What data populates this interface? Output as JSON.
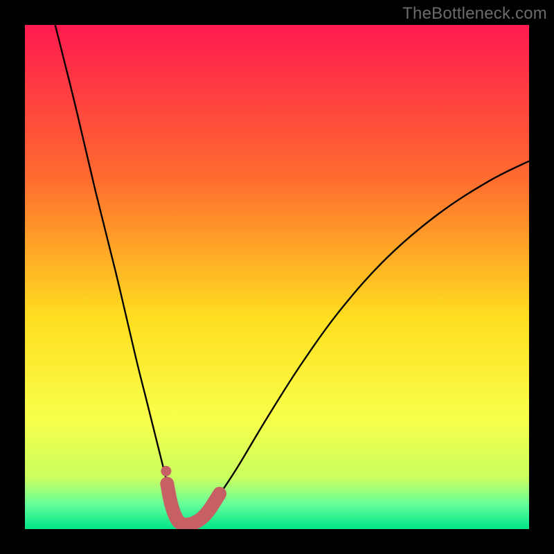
{
  "watermark": "TheBottleneck.com",
  "colors": {
    "frame": "#000000",
    "grad_top": "#ff1a4f",
    "grad_mid1": "#ff6a2f",
    "grad_mid2": "#ffde20",
    "grad_mid3": "#f8ff4a",
    "grad_low1": "#c8ff60",
    "grad_low2": "#66ff99",
    "grad_bottom": "#00e58a",
    "curve": "#000000",
    "marker_fill": "#c76065",
    "marker_stroke": "#c76065"
  },
  "chart_data": {
    "type": "line",
    "title": "",
    "xlabel": "",
    "ylabel": "",
    "xlim": [
      0,
      100
    ],
    "ylim": [
      0,
      100
    ],
    "series": [
      {
        "name": "bottleneck-curve",
        "x": [
          6,
          10,
          14,
          18,
          22,
          24,
          26,
          28,
          29.5,
          31,
          33,
          35,
          38,
          42,
          48,
          55,
          63,
          72,
          82,
          92,
          100
        ],
        "y": [
          100,
          84,
          67,
          51,
          34,
          26,
          18,
          10,
          4,
          1,
          1,
          2,
          6,
          12,
          22,
          33,
          44,
          54,
          62.5,
          69,
          73
        ]
      }
    ],
    "markers": {
      "name": "highlight-segment",
      "points": [
        {
          "x": 28.2,
          "y": 9
        },
        {
          "x": 29,
          "y": 5
        },
        {
          "x": 30,
          "y": 2.2
        },
        {
          "x": 31,
          "y": 1.1
        },
        {
          "x": 32.2,
          "y": 0.9
        },
        {
          "x": 33.5,
          "y": 1.2
        },
        {
          "x": 35,
          "y": 2.1
        },
        {
          "x": 36.4,
          "y": 3.6
        },
        {
          "x": 37.6,
          "y": 5.4
        },
        {
          "x": 38.6,
          "y": 7
        }
      ],
      "extra_dot": {
        "x": 28.0,
        "y": 11.5
      }
    },
    "grid": false,
    "legend": false
  }
}
